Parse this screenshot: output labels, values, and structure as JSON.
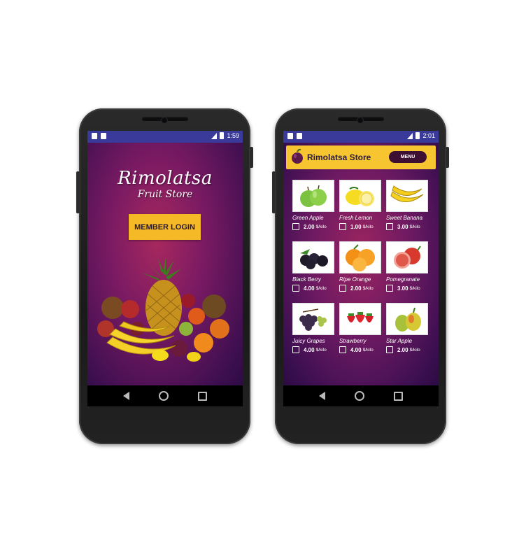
{
  "phone_left": {
    "status_time": "1:59",
    "logo_line1": "Rimolatsa",
    "logo_line2": "Fruit Store",
    "login_button": "MEMBER LOGIN"
  },
  "phone_right": {
    "status_time": "2:01",
    "header_title": "Rimolatsa Store",
    "menu_button": "MENU",
    "products": [
      {
        "name": "Green Apple",
        "price": "2.00",
        "unit": "$/kilo"
      },
      {
        "name": "Fresh Lemon",
        "price": "1.00",
        "unit": "$/kilo"
      },
      {
        "name": "Sweet Banana",
        "price": "3.00",
        "unit": "$/kilo"
      },
      {
        "name": "Black Berry",
        "price": "4.00",
        "unit": "$/kilo"
      },
      {
        "name": "Ripe Orange",
        "price": "2.00",
        "unit": "$/kilo"
      },
      {
        "name": "Pomegranate",
        "price": "3.00",
        "unit": "$/kilo"
      },
      {
        "name": "Juicy Grapes",
        "price": "4.00",
        "unit": "$/kilo"
      },
      {
        "name": "Strawberry",
        "price": "4.00",
        "unit": "$/kilo"
      },
      {
        "name": "Star Apple",
        "price": "2.00",
        "unit": "$/kilo"
      }
    ]
  },
  "colors": {
    "statusbar": "#3a3a9a",
    "button_yellow": "#f5b827",
    "menu_dark": "#3d1033"
  }
}
